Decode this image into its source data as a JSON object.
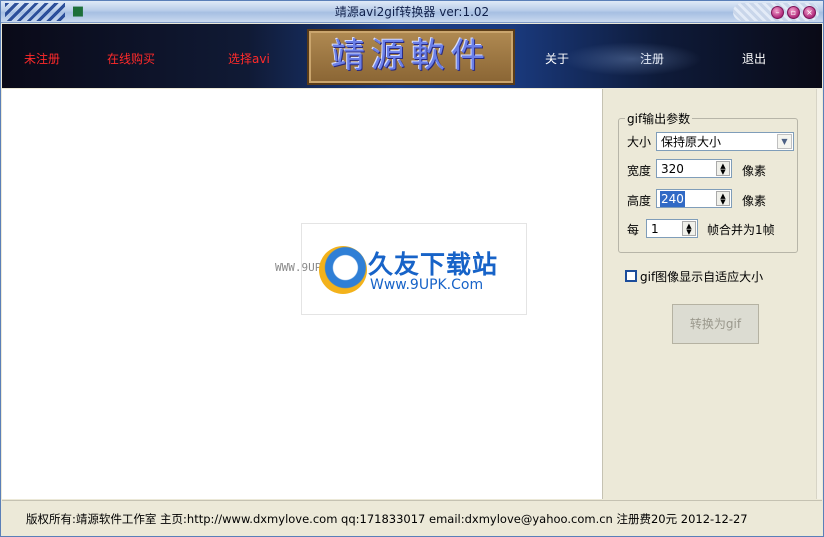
{
  "window": {
    "title": "靖源avi2gif转换器 ver:1.02"
  },
  "banner": {
    "links_left": [
      "未注册",
      "在线购买",
      "选择avi"
    ],
    "logo_text": "靖源軟件",
    "links_right": [
      "关于",
      "注册",
      "退出"
    ],
    "colors": {
      "left_link": "#ff2a2a",
      "right_link": "#ffffff"
    }
  },
  "watermark": {
    "small_url": "WWW.9UPK.COM",
    "title": "久友下载站",
    "url": "Www.9UPK.Com"
  },
  "panel": {
    "group_title": "gif输出参数",
    "size_label": "大小",
    "size_value": "保持原大小",
    "width_label": "宽度",
    "width_value": "320",
    "width_unit": "像素",
    "height_label": "高度",
    "height_value": "240",
    "height_unit": "像素",
    "every_label": "每",
    "every_value": "1",
    "every_suffix": "帧合并为1帧",
    "checkbox_label": "gif图像显示自适应大小",
    "checkbox_checked": false,
    "convert_button": "转换为gif"
  },
  "statusbar": {
    "text": "版权所有:靖源软件工作室 主页:http://www.dxmylove.com qq:171833017 email:dxmylove@yahoo.com.cn 注册费20元 2012-12-27"
  },
  "icons": [
    "app-icon",
    "minimize-icon",
    "maximize-icon",
    "close-icon",
    "dropdown-arrow-icon",
    "spin-arrow-icon"
  ]
}
